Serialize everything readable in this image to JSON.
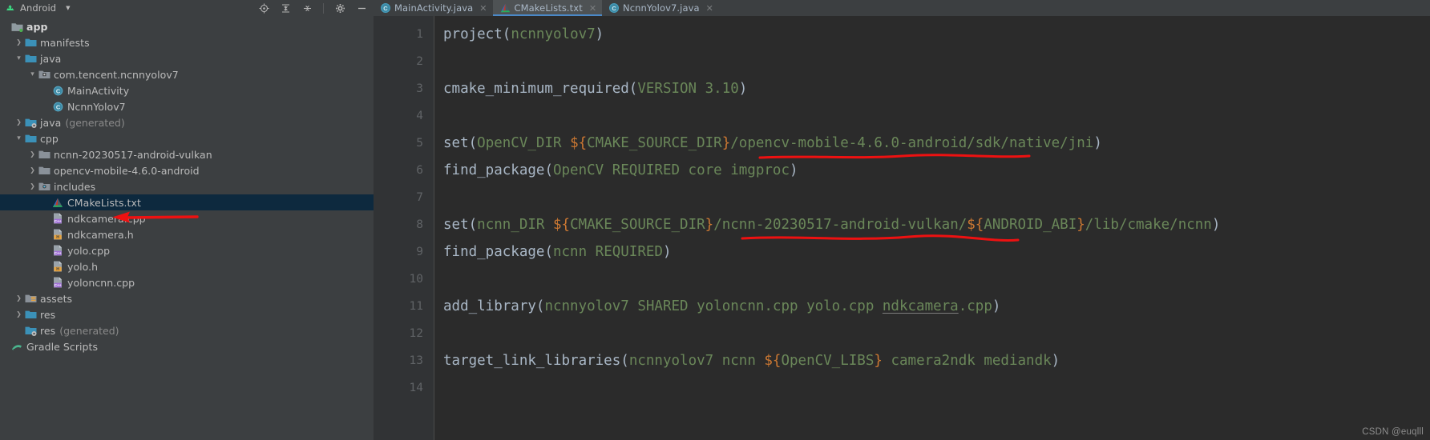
{
  "window": {
    "theme_bg": "#3c3f41",
    "editor_bg": "#2b2b2b",
    "accent": "#4a88c7",
    "annotation_color": "#ee1111"
  },
  "project_panel": {
    "title": "Android",
    "caret": "▼",
    "icons": [
      {
        "name": "locate-icon",
        "glyph": "target"
      },
      {
        "name": "collapse-all-icon",
        "glyph": "collapse"
      },
      {
        "name": "expand-all-icon",
        "glyph": "expand"
      },
      {
        "name": "settings-gear-icon",
        "glyph": "gear"
      },
      {
        "name": "hide-panel-icon",
        "glyph": "minus"
      }
    ]
  },
  "tabs": [
    {
      "label": "MainActivity.java",
      "icon": "java-class-icon",
      "active": false,
      "closable": true
    },
    {
      "label": "CMakeLists.txt",
      "icon": "cmake-icon",
      "active": true,
      "closable": true
    },
    {
      "label": "NcnnYolov7.java",
      "icon": "java-class-icon",
      "active": false,
      "closable": true
    }
  ],
  "tree": [
    {
      "label": "app",
      "sub": "",
      "depth": 0,
      "arrow": "",
      "icon": "module-folder-icon",
      "bold": true,
      "selected": false
    },
    {
      "label": "manifests",
      "sub": "",
      "depth": 1,
      "arrow": "collapsed",
      "icon": "folder-icon",
      "bold": false,
      "selected": false
    },
    {
      "label": "java",
      "sub": "",
      "depth": 1,
      "arrow": "expanded",
      "icon": "folder-icon",
      "bold": false,
      "selected": false
    },
    {
      "label": "com.tencent.ncnnyolov7",
      "sub": "",
      "depth": 2,
      "arrow": "expanded",
      "icon": "package-icon",
      "bold": false,
      "selected": false
    },
    {
      "label": "MainActivity",
      "sub": "",
      "depth": 3,
      "arrow": "",
      "icon": "java-class-icon",
      "bold": false,
      "selected": false
    },
    {
      "label": "NcnnYolov7",
      "sub": "",
      "depth": 3,
      "arrow": "",
      "icon": "java-class-icon",
      "bold": false,
      "selected": false
    },
    {
      "label": "java",
      "sub": "(generated)",
      "depth": 1,
      "arrow": "collapsed",
      "icon": "generated-folder-icon",
      "bold": false,
      "selected": false
    },
    {
      "label": "cpp",
      "sub": "",
      "depth": 1,
      "arrow": "expanded",
      "icon": "folder-icon",
      "bold": false,
      "selected": false
    },
    {
      "label": "ncnn-20230517-android-vulkan",
      "sub": "",
      "depth": 2,
      "arrow": "collapsed",
      "icon": "grey-folder-icon",
      "bold": false,
      "selected": false
    },
    {
      "label": "opencv-mobile-4.6.0-android",
      "sub": "",
      "depth": 2,
      "arrow": "collapsed",
      "icon": "grey-folder-icon",
      "bold": false,
      "selected": false
    },
    {
      "label": "includes",
      "sub": "",
      "depth": 2,
      "arrow": "collapsed",
      "icon": "includes-icon",
      "bold": false,
      "selected": false
    },
    {
      "label": "CMakeLists.txt",
      "sub": "",
      "depth": 3,
      "arrow": "",
      "icon": "cmake-icon",
      "bold": false,
      "selected": true
    },
    {
      "label": "ndkcamera.cpp",
      "sub": "",
      "depth": 3,
      "arrow": "",
      "icon": "cpp-file-icon",
      "bold": false,
      "selected": false
    },
    {
      "label": "ndkcamera.h",
      "sub": "",
      "depth": 3,
      "arrow": "",
      "icon": "h-file-icon",
      "bold": false,
      "selected": false
    },
    {
      "label": "yolo.cpp",
      "sub": "",
      "depth": 3,
      "arrow": "",
      "icon": "cpp-file-icon",
      "bold": false,
      "selected": false
    },
    {
      "label": "yolo.h",
      "sub": "",
      "depth": 3,
      "arrow": "",
      "icon": "h-file-icon",
      "bold": false,
      "selected": false
    },
    {
      "label": "yoloncnn.cpp",
      "sub": "",
      "depth": 3,
      "arrow": "",
      "icon": "cpp-file-icon",
      "bold": false,
      "selected": false
    },
    {
      "label": "assets",
      "sub": "",
      "depth": 1,
      "arrow": "collapsed",
      "icon": "assets-folder-icon",
      "bold": false,
      "selected": false
    },
    {
      "label": "res",
      "sub": "",
      "depth": 1,
      "arrow": "collapsed",
      "icon": "folder-icon",
      "bold": false,
      "selected": false
    },
    {
      "label": "res",
      "sub": "(generated)",
      "depth": 1,
      "arrow": "",
      "icon": "generated-folder-icon",
      "bold": false,
      "selected": false
    },
    {
      "label": "Gradle Scripts",
      "sub": "",
      "depth": 0,
      "arrow": "",
      "icon": "gradle-icon",
      "bold": false,
      "selected": false
    }
  ],
  "editor": {
    "line_numbers": [
      "1",
      "2",
      "3",
      "4",
      "5",
      "6",
      "7",
      "8",
      "9",
      "10",
      "11",
      "12",
      "13",
      "14"
    ],
    "lines": [
      {
        "n": "1",
        "tokens": [
          {
            "t": "project",
            "c": "cmd"
          },
          {
            "t": "(",
            "c": "paren"
          },
          {
            "t": "ncnnyolov7",
            "c": "arg"
          },
          {
            "t": ")",
            "c": "paren"
          }
        ]
      },
      {
        "n": "2",
        "tokens": []
      },
      {
        "n": "3",
        "tokens": [
          {
            "t": "cmake_minimum_required",
            "c": "cmd"
          },
          {
            "t": "(",
            "c": "paren"
          },
          {
            "t": "VERSION 3.10",
            "c": "arg"
          },
          {
            "t": ")",
            "c": "paren"
          }
        ]
      },
      {
        "n": "4",
        "tokens": []
      },
      {
        "n": "5",
        "tokens": [
          {
            "t": "set",
            "c": "cmd"
          },
          {
            "t": "(",
            "c": "paren"
          },
          {
            "t": "OpenCV_DIR ",
            "c": "arg"
          },
          {
            "t": "${",
            "c": "var"
          },
          {
            "t": "CMAKE_SOURCE_DIR",
            "c": "arg"
          },
          {
            "t": "}",
            "c": "var"
          },
          {
            "t": "/opencv-mobile-4.6.0-android/sdk/native/jni",
            "c": "arg"
          },
          {
            "t": ")",
            "c": "paren"
          }
        ]
      },
      {
        "n": "6",
        "tokens": [
          {
            "t": "find_package",
            "c": "cmd"
          },
          {
            "t": "(",
            "c": "paren"
          },
          {
            "t": "OpenCV REQUIRED core imgproc",
            "c": "arg"
          },
          {
            "t": ")",
            "c": "paren"
          }
        ]
      },
      {
        "n": "7",
        "tokens": []
      },
      {
        "n": "8",
        "tokens": [
          {
            "t": "set",
            "c": "cmd"
          },
          {
            "t": "(",
            "c": "paren"
          },
          {
            "t": "ncnn_DIR ",
            "c": "arg"
          },
          {
            "t": "${",
            "c": "var"
          },
          {
            "t": "CMAKE_SOURCE_DIR",
            "c": "arg"
          },
          {
            "t": "}",
            "c": "var"
          },
          {
            "t": "/ncnn-20230517-android-vulkan/",
            "c": "arg"
          },
          {
            "t": "${",
            "c": "var"
          },
          {
            "t": "ANDROID_ABI",
            "c": "arg"
          },
          {
            "t": "}",
            "c": "var"
          },
          {
            "t": "/lib/cmake/ncnn",
            "c": "arg"
          },
          {
            "t": ")",
            "c": "paren"
          }
        ]
      },
      {
        "n": "9",
        "tokens": [
          {
            "t": "find_package",
            "c": "cmd"
          },
          {
            "t": "(",
            "c": "paren"
          },
          {
            "t": "ncnn REQUIRED",
            "c": "arg"
          },
          {
            "t": ")",
            "c": "paren"
          }
        ]
      },
      {
        "n": "10",
        "tokens": []
      },
      {
        "n": "11",
        "tokens": [
          {
            "t": "add_library",
            "c": "cmd"
          },
          {
            "t": "(",
            "c": "paren"
          },
          {
            "t": "ncnnyolov7 SHARED yoloncnn.cpp yolo.cpp ",
            "c": "arg"
          },
          {
            "t": "ndkcamera",
            "c": "arg-underline"
          },
          {
            "t": ".cpp",
            "c": "arg"
          },
          {
            "t": ")",
            "c": "paren"
          }
        ]
      },
      {
        "n": "12",
        "tokens": []
      },
      {
        "n": "13",
        "tokens": [
          {
            "t": "target_link_libraries",
            "c": "cmd"
          },
          {
            "t": "(",
            "c": "paren"
          },
          {
            "t": "ncnnyolov7 ncnn ",
            "c": "arg"
          },
          {
            "t": "${",
            "c": "var"
          },
          {
            "t": "OpenCV_LIBS",
            "c": "arg"
          },
          {
            "t": "}",
            "c": "var"
          },
          {
            "t": " camera2ndk mediandk",
            "c": "arg"
          },
          {
            "t": ")",
            "c": "paren"
          }
        ]
      },
      {
        "n": "14",
        "tokens": []
      }
    ]
  },
  "annotations": [
    {
      "name": "red-underline-opencv-path",
      "target": "opencv-mobile-4.6.0-android"
    },
    {
      "name": "red-underline-ncnn-path",
      "target": "ncnn-20230517-android-vulkan"
    },
    {
      "name": "red-arrow-cmakelists",
      "target": "CMakeLists.txt"
    }
  ],
  "watermark": {
    "text": "CSDN @euqlll"
  }
}
